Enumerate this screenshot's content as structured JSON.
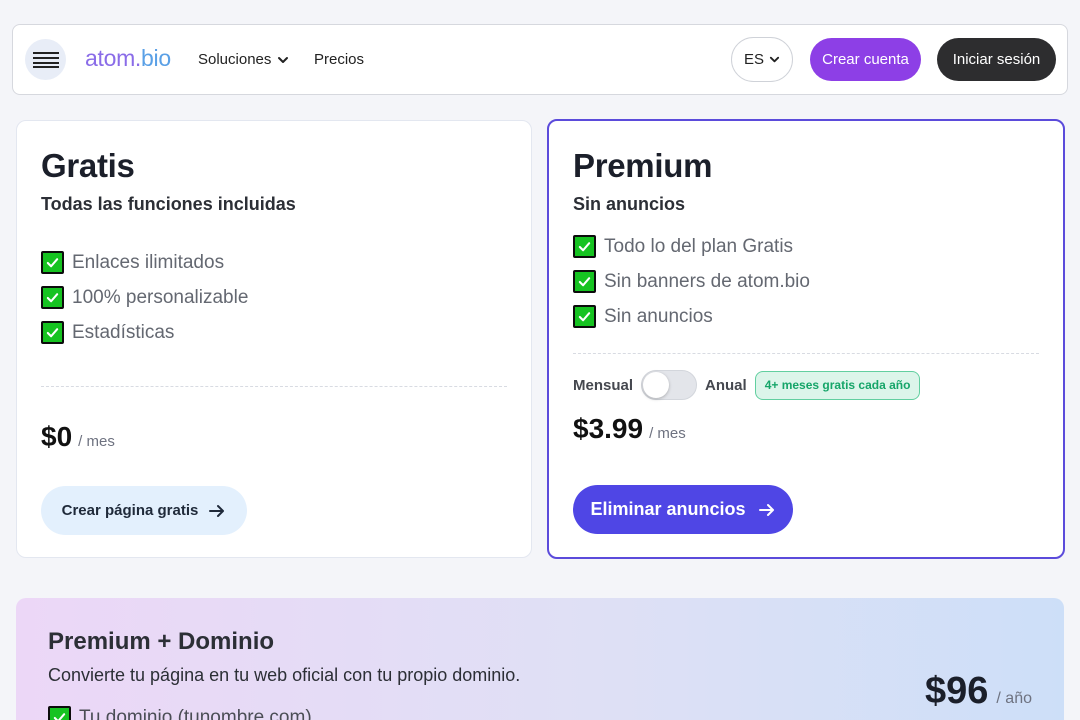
{
  "nav": {
    "logo_main": "atom.",
    "logo_tld": "bio",
    "links": [
      "Soluciones",
      "Precios"
    ],
    "language": "ES",
    "signup_label": "Crear cuenta",
    "login_label": "Iniciar sesión"
  },
  "free_plan": {
    "title": "Gratis",
    "subtitle": "Todas las funciones incluidas",
    "features": [
      "Enlaces ilimitados",
      "100% personalizable",
      "Estadísticas"
    ],
    "price": "$0",
    "period": "/ mes",
    "cta": "Crear página gratis"
  },
  "premium_plan": {
    "title": "Premium",
    "subtitle": "Sin anuncios",
    "features": [
      "Todo lo del plan Gratis",
      "Sin banners de atom.bio",
      "Sin anuncios"
    ],
    "billing_monthly": "Mensual",
    "billing_yearly": "Anual",
    "billing_toggle_annual": false,
    "promo_badge": "4+ meses gratis cada año",
    "price": "$3.99",
    "period": "/ mes",
    "cta": "Eliminar anuncios"
  },
  "domain_plan": {
    "title": "Premium + Dominio",
    "description": "Convierte tu página en tu web oficial con tu propio dominio.",
    "features": [
      "Tu dominio (tunombre.com)"
    ],
    "price": "$96",
    "period": "/ año"
  },
  "colors": {
    "accent": "#4f46e5",
    "signup": "#8d3fe6",
    "check": "#16c321",
    "promo": "#16a569"
  }
}
